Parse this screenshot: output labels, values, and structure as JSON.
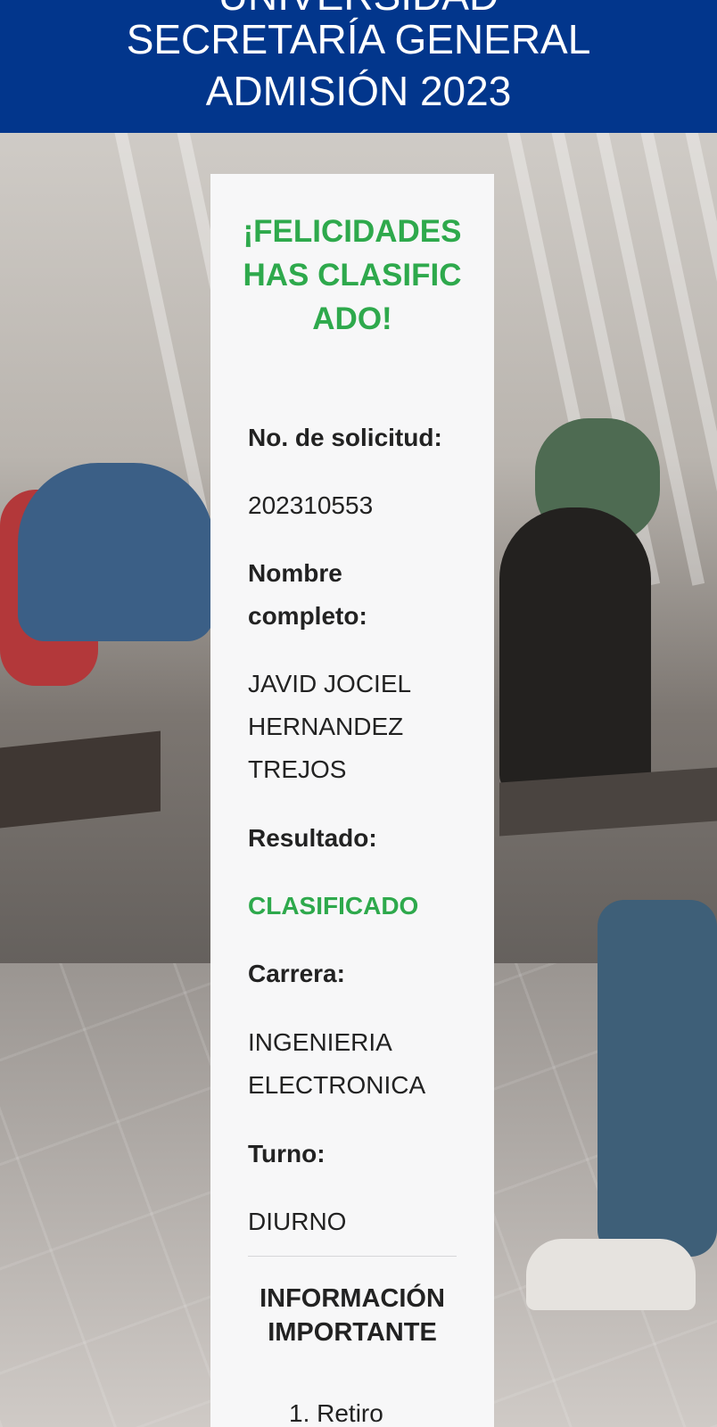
{
  "header": {
    "partial_line": "UNIVERSIDAD",
    "line1": "SECRETARÍA GENERAL",
    "line2": "ADMISIÓN 2023",
    "bg_color": "#02368c"
  },
  "card": {
    "title": "¡FELICIDADES HAS CLASIFICADO!",
    "fields": {
      "solicitud_label": "No. de solicitud:",
      "solicitud_value": "202310553",
      "nombre_label": "Nombre completo:",
      "nombre_value": "JAVID JOCIEL HERNANDEZ TREJOS",
      "resultado_label": "Resultado:",
      "resultado_value": "CLASIFICADO",
      "carrera_label": "Carrera:",
      "carrera_value": "INGENIERIA ELECTRONICA",
      "turno_label": "Turno:",
      "turno_value": "DIURNO"
    },
    "info_title": "INFORMACIÓN IMPORTANTE",
    "info_items": [
      "1. Retiro"
    ],
    "accent_color": "#2ea94c"
  }
}
